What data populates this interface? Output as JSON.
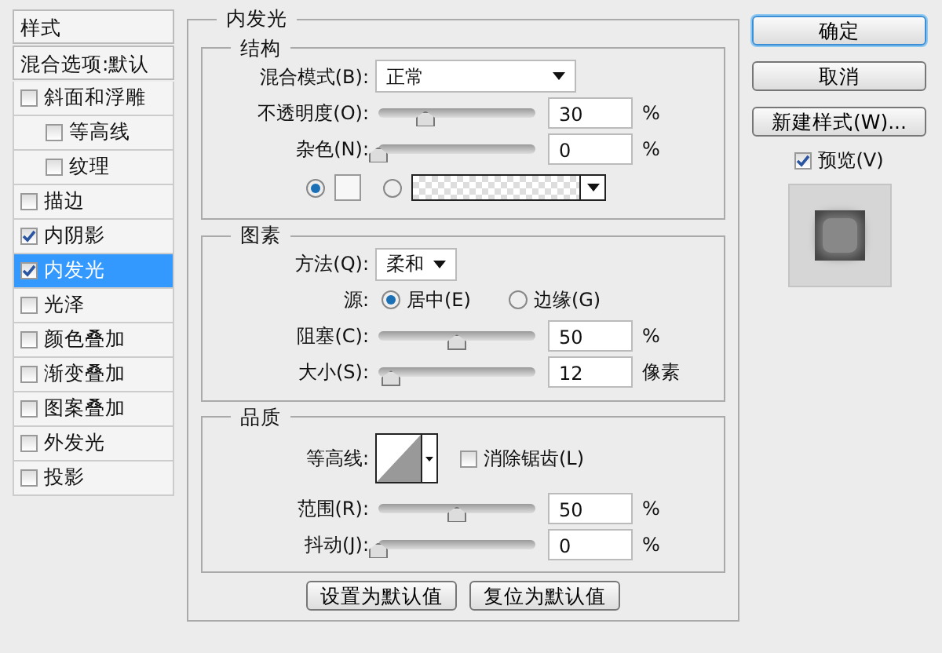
{
  "sidebar": {
    "header": "样式",
    "blend_options": "混合选项:默认",
    "items": [
      {
        "label": "斜面和浮雕",
        "checked": false,
        "selected": false,
        "children": [
          {
            "label": "等高线",
            "checked": false,
            "selected": false
          },
          {
            "label": "纹理",
            "checked": false,
            "selected": false
          }
        ]
      },
      {
        "label": "描边",
        "checked": false,
        "selected": false
      },
      {
        "label": "内阴影",
        "checked": true,
        "selected": false
      },
      {
        "label": "内发光",
        "checked": true,
        "selected": true
      },
      {
        "label": "光泽",
        "checked": false,
        "selected": false
      },
      {
        "label": "颜色叠加",
        "checked": false,
        "selected": false
      },
      {
        "label": "渐变叠加",
        "checked": false,
        "selected": false
      },
      {
        "label": "图案叠加",
        "checked": false,
        "selected": false
      },
      {
        "label": "外发光",
        "checked": false,
        "selected": false
      },
      {
        "label": "投影",
        "checked": false,
        "selected": false
      }
    ]
  },
  "panel": {
    "title": "内发光",
    "structure": {
      "title": "结构",
      "blend_mode": {
        "label": "混合模式(B):",
        "value": "正常"
      },
      "sliders": [
        {
          "label": "不透明度(O):",
          "level": 0.3,
          "value": "30",
          "unit": "%"
        },
        {
          "label": "杂色(N):",
          "level": 0,
          "value": "0",
          "unit": "%"
        }
      ],
      "fill_options": [
        {
          "kind": "color",
          "selected": true
        },
        {
          "kind": "gradient",
          "selected": false
        }
      ]
    },
    "elements": {
      "title": "图素",
      "method": {
        "label": "方法(Q):",
        "value": "柔和"
      },
      "source_label": "源:",
      "source_options": [
        {
          "label": "居中(E)",
          "selected": true
        },
        {
          "label": "边缘(G)",
          "selected": false
        }
      ],
      "sliders": [
        {
          "label": "阻塞(C):",
          "level": 0.5,
          "value": "50",
          "unit": "%"
        },
        {
          "label": "大小(S):",
          "level": 0.08,
          "value": "12",
          "unit": "像素"
        }
      ]
    },
    "quality": {
      "title": "品质",
      "contour_label": "等高线:",
      "anti_alias": {
        "label": "消除锯齿(L)",
        "checked": false
      },
      "sliders": [
        {
          "label": "范围(R):",
          "level": 0.5,
          "value": "50",
          "unit": "%"
        },
        {
          "label": "抖动(J):",
          "level": 0,
          "value": "0",
          "unit": "%"
        }
      ]
    },
    "buttons": [
      "设置为默认值",
      "复位为默认值"
    ]
  },
  "actions": {
    "buttons": [
      {
        "label": "确定",
        "kind": "default"
      },
      {
        "label": "取消",
        "kind": "normal"
      },
      {
        "label": "新建样式(W)...",
        "kind": "normal"
      }
    ],
    "preview": {
      "label": "预览(V)",
      "checked": true
    }
  }
}
